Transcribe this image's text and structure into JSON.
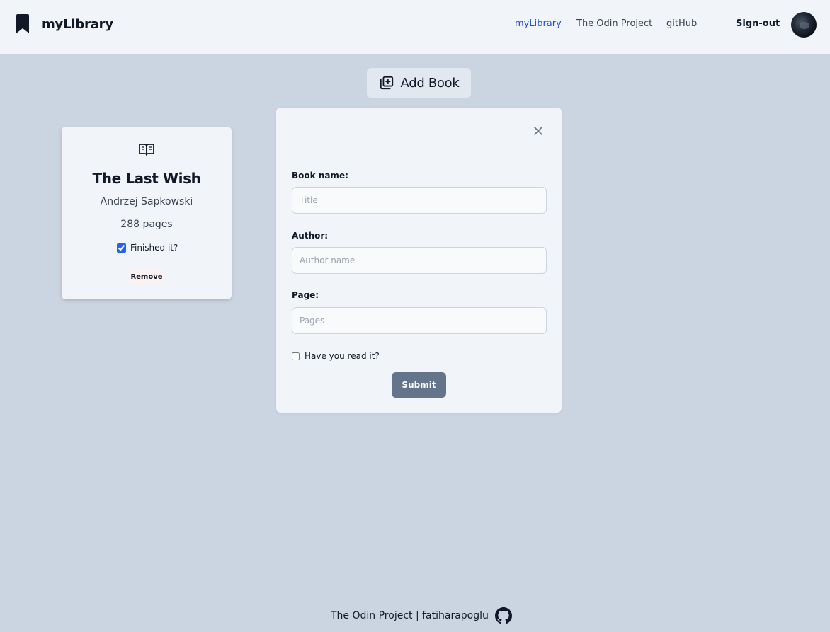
{
  "header": {
    "brand": "myLibrary",
    "nav": [
      {
        "label": "myLibrary",
        "active": true
      },
      {
        "label": "The Odin Project",
        "active": false
      },
      {
        "label": "gitHub",
        "active": false
      }
    ],
    "signout_label": "Sign-out",
    "accent_color": "#1d4ed8"
  },
  "toolbar": {
    "add_book_label": "Add Book"
  },
  "books": [
    {
      "title": "The Last Wish",
      "author": "Andrzej Sapkowski",
      "pages": "288 pages",
      "finished_label": "Finished it?",
      "finished": true,
      "remove_label": "Remove"
    }
  ],
  "form": {
    "book_name_label": "Book name:",
    "book_name_placeholder": "Title",
    "author_label": "Author:",
    "author_placeholder": "Author name",
    "page_label": "Page:",
    "page_placeholder": "Pages",
    "read_label": "Have you read it?",
    "read_checked": false,
    "submit_label": "Submit"
  },
  "footer": {
    "text": "The Odin Project | fatiharapoglu"
  },
  "icons": {
    "brand": "bookmark-icon",
    "add_book": "library-add-icon",
    "book": "open-book-icon",
    "close": "close-icon",
    "footer": "github-icon"
  }
}
